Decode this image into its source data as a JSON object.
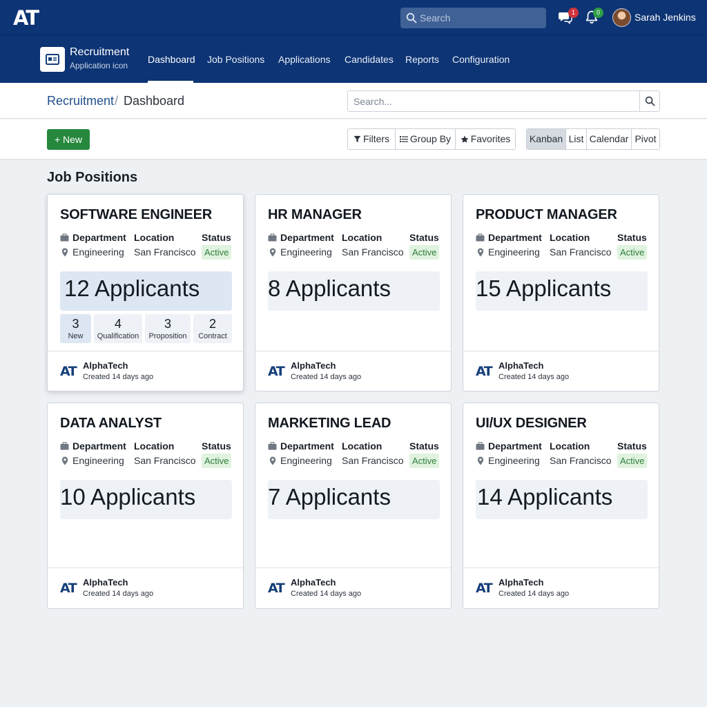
{
  "brand": {
    "logo": "AT"
  },
  "topbar": {
    "search_placeholder": "Search",
    "messages_count": "1",
    "notifications_count": "0",
    "user_name": "Sarah Jenkins",
    "colors": {
      "bar": "#0d3474",
      "msg_badge": "#d0343a",
      "notif_badge": "#2e9d45"
    }
  },
  "appnav": {
    "app_name": "Recruitment",
    "app_sub": "Application icon",
    "menu": [
      "Dashboard",
      "Job Positions",
      "Applications",
      "Candidates",
      "Reports",
      "Configuration"
    ],
    "active": "Dashboard"
  },
  "breadcrumb": {
    "parent": "Recruitment",
    "separator": "/",
    "current": "Dashboard"
  },
  "search": {
    "placeholder": "Search..."
  },
  "controls": {
    "new_label": "New",
    "filters": "Filters",
    "group_by": "Group By",
    "favorites": "Favorites",
    "views": [
      "Kanban",
      "List",
      "Calendar",
      "Pivot"
    ],
    "active_view": "Kanban"
  },
  "section_title": "Job Positions",
  "labels": {
    "department": "Department",
    "location": "Location",
    "status": "Status"
  },
  "cards": [
    {
      "title": "SOFTWARE ENGINEER",
      "department": "Engineering",
      "location": "San Francisco",
      "status": "Active",
      "applicants": "12 Applicants",
      "stages": [
        {
          "count": "3",
          "label": "New"
        },
        {
          "count": "4",
          "label": "Qualification"
        },
        {
          "count": "3",
          "label": "Proposition"
        },
        {
          "count": "2",
          "label": "Contract"
        }
      ],
      "company": "AlphaTech",
      "created": "Created 14 days ago"
    },
    {
      "title": "HR MANAGER",
      "department": "Engineering",
      "location": "San Francisco",
      "status": "Active",
      "applicants": "8 Applicants",
      "company": "AlphaTech",
      "created": "Created 14 days ago"
    },
    {
      "title": "PRODUCT MANAGER",
      "department": "Engineering",
      "location": "San Francisco",
      "status": "Active",
      "applicants": "15 Applicants",
      "company": "AlphaTech",
      "created": "Created 14 days ago"
    },
    {
      "title": "DATA ANALYST",
      "department": "Engineering",
      "location": "San Francisco",
      "status": "Active",
      "applicants": "10 Applicants",
      "company": "AlphaTech",
      "created": "Created 14 days ago"
    },
    {
      "title": "MARKETING LEAD",
      "department": "Engineering",
      "location": "San Francisco",
      "status": "Active",
      "applicants": "7 Applicants",
      "company": "AlphaTech",
      "created": "Created 14 days ago"
    },
    {
      "title": "UI/UX DESIGNER",
      "department": "Engineering",
      "location": "San Francisco",
      "status": "Active",
      "applicants": "14 Applicants",
      "company": "AlphaTech",
      "created": "Created 14 days ago"
    }
  ]
}
